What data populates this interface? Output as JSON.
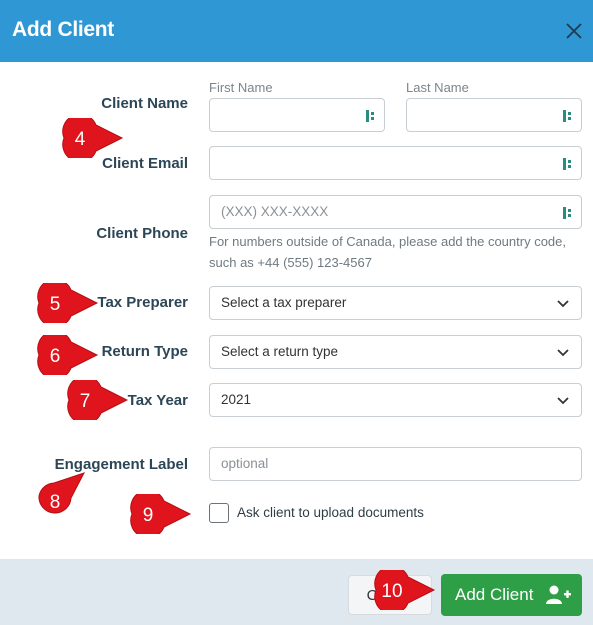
{
  "dialog": {
    "title": "Add Client",
    "close_icon": "close-icon"
  },
  "form": {
    "client_name_label": "Client Name",
    "first_name_label": "First Name",
    "last_name_label": "Last Name",
    "first_name_value": "",
    "last_name_value": "",
    "client_email_label": "Client Email",
    "client_email_value": "",
    "client_phone_label": "Client Phone",
    "client_phone_placeholder": "(XXX) XXX-XXXX",
    "phone_helper": "For numbers outside of Canada, please add the country code, such as +44 (555) 123-4567",
    "tax_preparer_label": "Tax Preparer",
    "tax_preparer_value": "Select a tax preparer",
    "return_type_label": "Return Type",
    "return_type_value": "Select a return type",
    "tax_year_label": "Tax Year",
    "tax_year_value": "2021",
    "engagement_label_label": "Engagement Label",
    "engagement_label_placeholder": "optional",
    "upload_checkbox_label": "Ask client to upload documents",
    "upload_checkbox_checked": false
  },
  "footer": {
    "cancel_label": "Cancel",
    "add_client_label": "Add Client",
    "add_client_icon": "add-user-icon"
  },
  "markers": [
    "4",
    "5",
    "6",
    "7",
    "8",
    "9",
    "10"
  ],
  "colors": {
    "header": "#2e97d4",
    "primary_button": "#2e9f46",
    "footer": "#dfe8ef",
    "marker": "#e0141c",
    "label": "#2c4657"
  }
}
